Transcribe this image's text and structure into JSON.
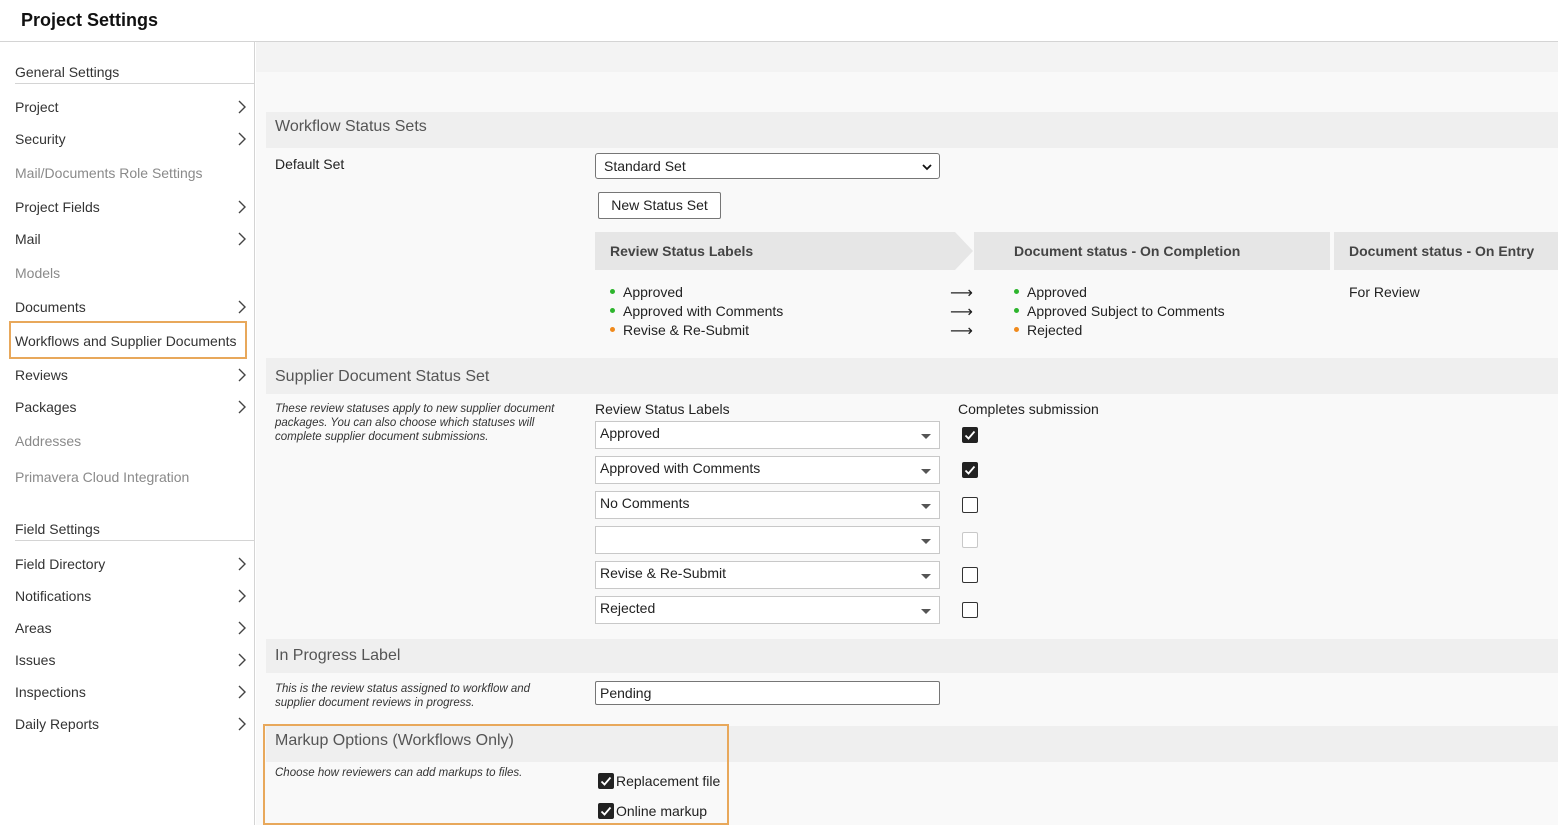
{
  "header": {
    "title": "Project Settings"
  },
  "sidebar": {
    "general_heading": "General Settings",
    "general_items": [
      {
        "label": "Project",
        "chevron": true,
        "disabled": false
      },
      {
        "label": "Security",
        "chevron": true,
        "disabled": false
      },
      {
        "label": "Mail/Documents Role Settings",
        "chevron": false,
        "disabled": true
      },
      {
        "label": "Project Fields",
        "chevron": true,
        "disabled": false
      },
      {
        "label": "Mail",
        "chevron": true,
        "disabled": false
      },
      {
        "label": "Models",
        "chevron": false,
        "disabled": true
      },
      {
        "label": "Documents",
        "chevron": true,
        "disabled": false
      },
      {
        "label": "Workflows and Supplier Documents",
        "chevron": false,
        "disabled": false,
        "selected": true
      },
      {
        "label": "Reviews",
        "chevron": true,
        "disabled": false
      },
      {
        "label": "Packages",
        "chevron": true,
        "disabled": false
      },
      {
        "label": "Addresses",
        "chevron": false,
        "disabled": true
      },
      {
        "label": "Primavera Cloud Integration",
        "chevron": false,
        "disabled": true
      }
    ],
    "field_heading": "Field Settings",
    "field_items": [
      {
        "label": "Field Directory",
        "chevron": true
      },
      {
        "label": "Notifications",
        "chevron": true
      },
      {
        "label": "Areas",
        "chevron": true
      },
      {
        "label": "Issues",
        "chevron": true
      },
      {
        "label": "Inspections",
        "chevron": true
      },
      {
        "label": "Daily Reports",
        "chevron": true
      }
    ]
  },
  "workflow_status_sets": {
    "title": "Workflow Status Sets",
    "default_set_label": "Default Set",
    "default_set_value": "Standard Set",
    "new_button": "New Status Set",
    "col_review": "Review Status Labels",
    "col_completion": "Document status - On Completion",
    "col_entry": "Document status - On Entry",
    "review_labels": [
      {
        "label": "Approved",
        "color": "#2db52d"
      },
      {
        "label": "Approved with Comments",
        "color": "#2db52d"
      },
      {
        "label": "Revise & Re-Submit",
        "color": "#f08a1c"
      }
    ],
    "completion_labels": [
      {
        "label": "Approved",
        "color": "#2db52d"
      },
      {
        "label": "Approved Subject to Comments",
        "color": "#2db52d"
      },
      {
        "label": "Rejected",
        "color": "#f08a1c"
      }
    ],
    "arrow_glyph": "⟶",
    "entry_label": "For Review"
  },
  "supplier_status_set": {
    "title": "Supplier Document Status Set",
    "note": "These review statuses apply to new supplier document packages. You can also choose which statuses will complete supplier document submissions.",
    "col_review": "Review Status Labels",
    "col_completes": "Completes submission",
    "rows": [
      {
        "value": "Approved",
        "completes": true,
        "disabled": false
      },
      {
        "value": "Approved with Comments",
        "completes": true,
        "disabled": false
      },
      {
        "value": "No Comments",
        "completes": false,
        "disabled": false
      },
      {
        "value": "",
        "completes": false,
        "disabled": true
      },
      {
        "value": "Revise & Re-Submit",
        "completes": false,
        "disabled": false
      },
      {
        "value": "Rejected",
        "completes": false,
        "disabled": false
      }
    ]
  },
  "in_progress": {
    "title": "In Progress Label",
    "note": "This is the review status assigned to workflow and supplier document reviews in progress.",
    "value": "Pending"
  },
  "markup_options": {
    "title": "Markup Options (Workflows Only)",
    "note": "Choose how reviewers can add markups to files.",
    "options": [
      {
        "label": "Replacement file",
        "checked": true
      },
      {
        "label": "Online markup",
        "checked": true
      }
    ]
  },
  "colors": {
    "highlight": "#e8a85b",
    "green": "#2db52d",
    "orange": "#f08a1c"
  }
}
